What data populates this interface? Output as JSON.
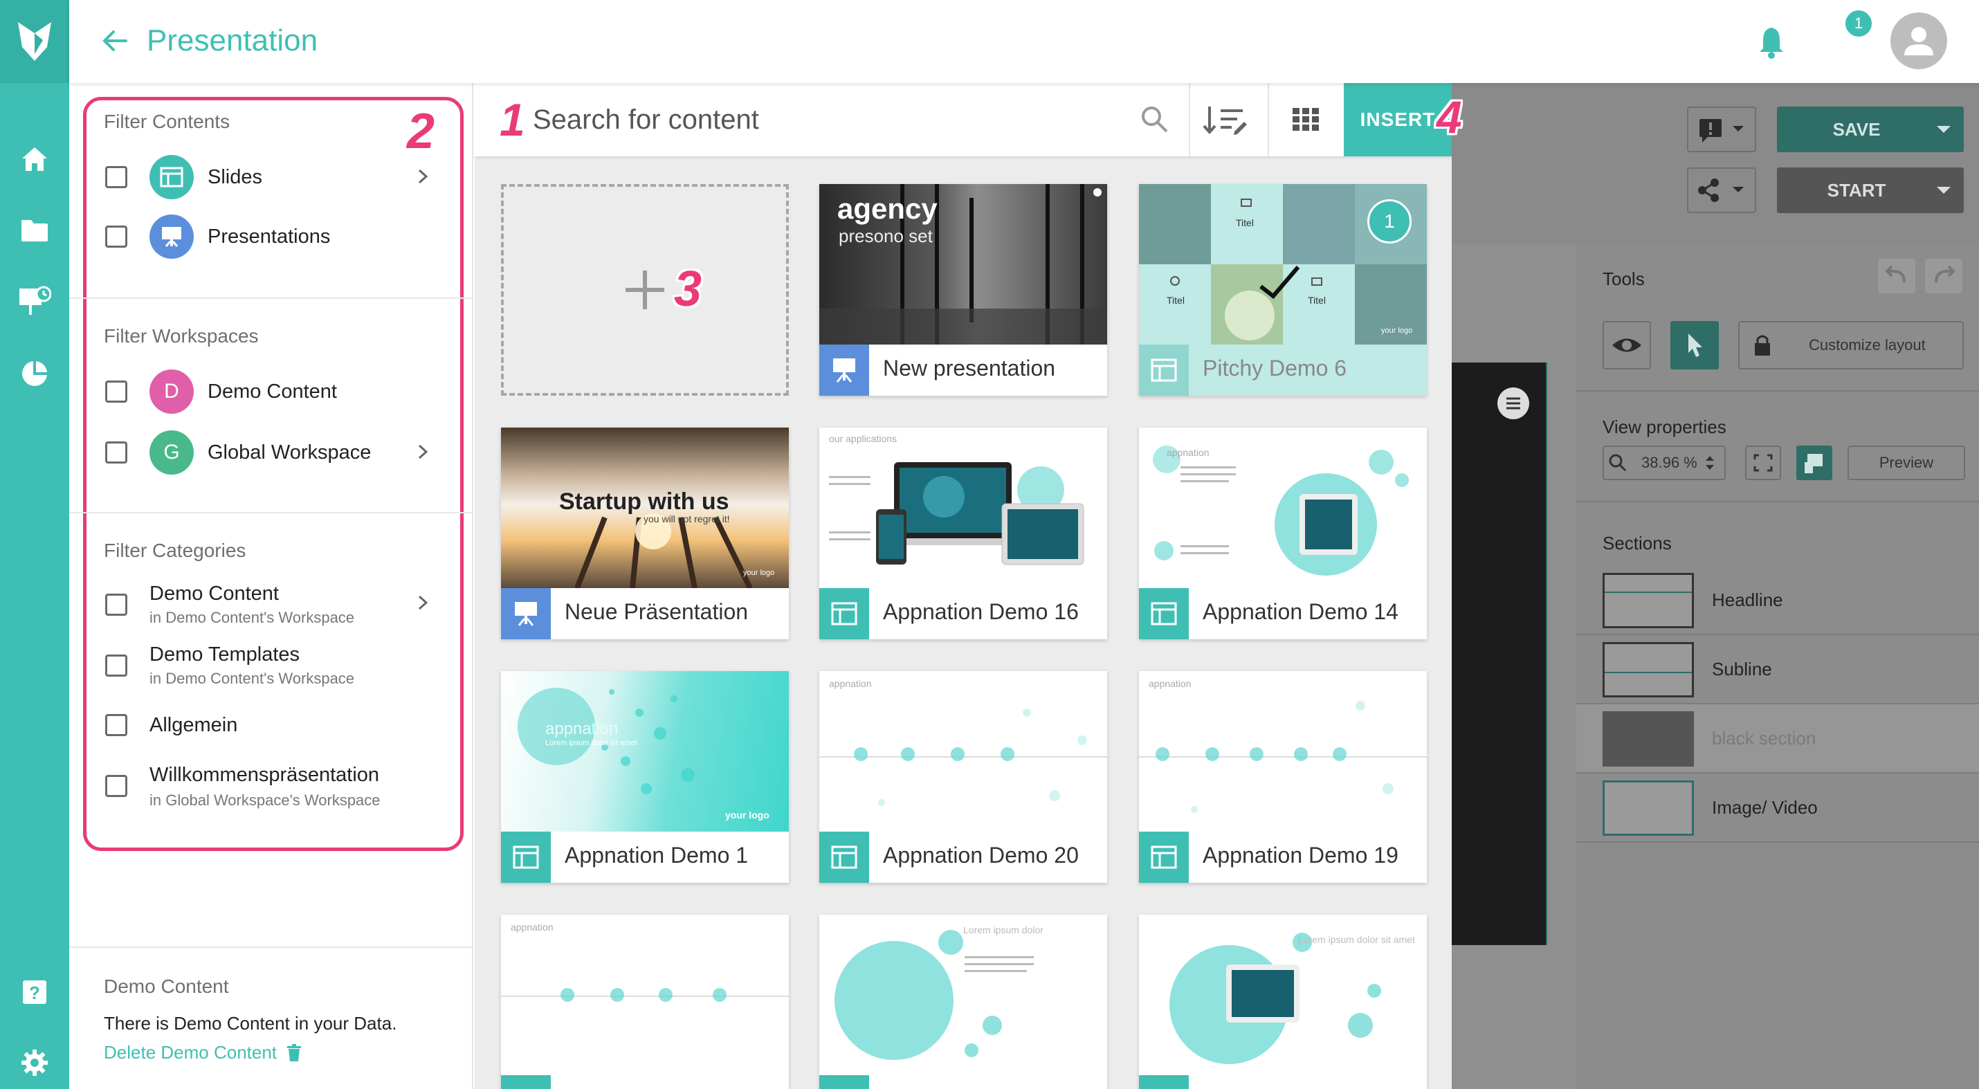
{
  "app": {
    "title": "Presentation",
    "notification_count": "1",
    "accent_color": "#3fbfb3",
    "callout_color": "#ea3a78"
  },
  "rail": {
    "icons": [
      "home-icon",
      "folder-icon",
      "presentation-icon",
      "pie-chart-icon",
      "help-icon",
      "settings-icon"
    ]
  },
  "filters": {
    "contents_title": "Filter Contents",
    "contents": [
      {
        "label": "Slides",
        "icon": "slide-icon"
      },
      {
        "label": "Presentations",
        "icon": "presentation-icon"
      }
    ],
    "workspaces_title": "Filter Workspaces",
    "workspaces": [
      {
        "label": "Demo Content",
        "initial": "D",
        "color": "#e05fa8"
      },
      {
        "label": "Global Workspace",
        "initial": "G",
        "color": "#49b98c"
      }
    ],
    "categories_title": "Filter Categories",
    "categories": [
      {
        "label": "Demo Content",
        "sub": "in Demo Content's Workspace"
      },
      {
        "label": "Demo Templates",
        "sub": "in Demo Content's Workspace"
      },
      {
        "label": "Allgemein",
        "sub": ""
      },
      {
        "label": "Willkommenspräsentation",
        "sub": "in Global Workspace's Workspace"
      }
    ],
    "demo_title": "Demo Content",
    "demo_text": "There is Demo Content in your Data.",
    "demo_link": "Delete Demo Content"
  },
  "callouts": {
    "one": "1",
    "two": "2",
    "three": "3",
    "four": "4"
  },
  "toolbar": {
    "search_placeholder": "Search for content",
    "insert_label": "INSERT"
  },
  "cards": [
    {
      "label": "New presentation",
      "type": "presentation",
      "thumb_title": "agency",
      "thumb_sub": "presono set"
    },
    {
      "label": "Pitchy Demo 6",
      "type": "slide",
      "selected": true,
      "selection_number": "1",
      "thumb_texts": [
        "Titel",
        "Titel",
        "Titel",
        "your logo"
      ]
    },
    {
      "label": "Neue Präsentation",
      "type": "presentation",
      "thumb_title": "Startup with us",
      "thumb_sub": "you will not regret it!",
      "thumb_logo": "your logo"
    },
    {
      "label": "Appnation Demo 16",
      "type": "slide",
      "thumb_title": "our applications"
    },
    {
      "label": "Appnation Demo 14",
      "type": "slide",
      "thumb_title": "appnation"
    },
    {
      "label": "Appnation Demo 1",
      "type": "slide",
      "thumb_title": "appnation",
      "thumb_sub": "Lorem ipsum dolor sit amet",
      "thumb_logo": "your logo"
    },
    {
      "label": "Appnation Demo 20",
      "type": "slide",
      "thumb_title": "appnation"
    },
    {
      "label": "Appnation Demo 19",
      "type": "slide",
      "thumb_title": "appnation"
    },
    {
      "label": "",
      "type": "slide",
      "thumb_title": "appnation"
    },
    {
      "label": "",
      "type": "slide",
      "thumb_title": "Lorem ipsum dolor"
    },
    {
      "label": "",
      "type": "slide",
      "thumb_title": "Lorem ipsum dolor sit amet"
    }
  ],
  "editor": {
    "save_label": "SAVE",
    "start_label": "START",
    "tools_title": "Tools",
    "customize_label": "Customize layout",
    "view_title": "View properties",
    "zoom": "38.96 %",
    "preview_label": "Preview",
    "sections_title": "Sections",
    "sections": [
      "Headline",
      "Subline",
      "black section",
      "Image/ Video"
    ]
  }
}
